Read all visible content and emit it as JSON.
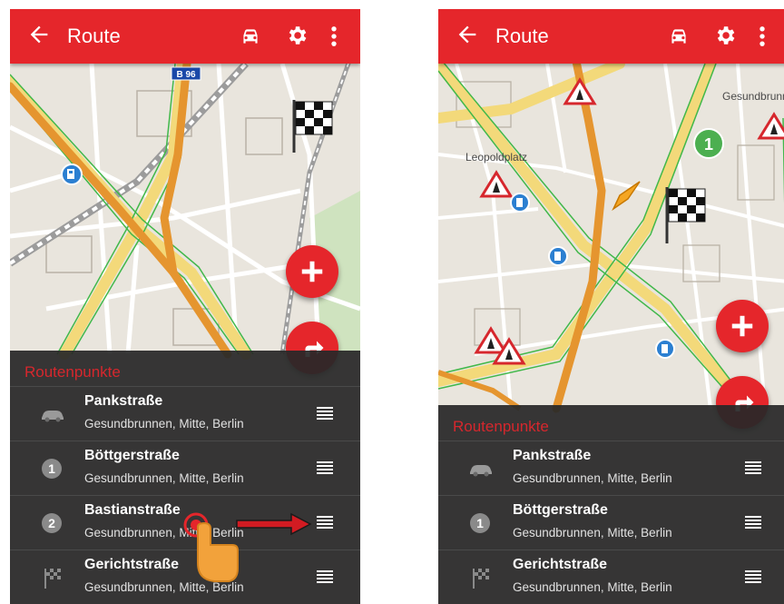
{
  "appbar": {
    "title": "Route",
    "back_icon": "arrow-back-icon",
    "vehicle_icon": "car-icon",
    "settings_icon": "gear-icon",
    "overflow_icon": "more-vert-icon",
    "color": "#e5262b"
  },
  "left": {
    "map": {
      "road_badge": "B 96"
    },
    "panel": {
      "title": "Routenpunkte",
      "rows": [
        {
          "icon": "car-icon",
          "name": "Pankstraße",
          "address": "Gesundbrunnen, Mitte, Berlin"
        },
        {
          "icon": "waypoint-1-icon",
          "badge": "1",
          "name": "Böttgerstraße",
          "address": "Gesundbrunnen, Mitte, Berlin"
        },
        {
          "icon": "waypoint-2-icon",
          "badge": "2",
          "name": "Bastianstraße",
          "address": "Gesundbrunnen, Mitte, Berlin"
        },
        {
          "icon": "finish-flag-icon",
          "name": "Gerichtstraße",
          "address": "Gesundbrunnen, Mitte, Berlin"
        }
      ]
    }
  },
  "right": {
    "map": {
      "place_label_1": "Leopoldplatz",
      "place_label_2": "Gesundbrunn",
      "waypoint_badge": "1"
    },
    "panel": {
      "title": "Routenpunkte",
      "rows": [
        {
          "icon": "car-icon",
          "name": "Pankstraße",
          "address": "Gesundbrunnen, Mitte, Berlin"
        },
        {
          "icon": "waypoint-1-icon",
          "badge": "1",
          "name": "Böttgerstraße",
          "address": "Gesundbrunnen, Mitte, Berlin"
        },
        {
          "icon": "finish-flag-icon",
          "name": "Gerichtstraße",
          "address": "Gesundbrunnen, Mitte, Berlin"
        }
      ]
    }
  },
  "annotation": {
    "gesture_icon": "drag-hand-icon",
    "arrow_icon": "red-arrow-icon"
  }
}
